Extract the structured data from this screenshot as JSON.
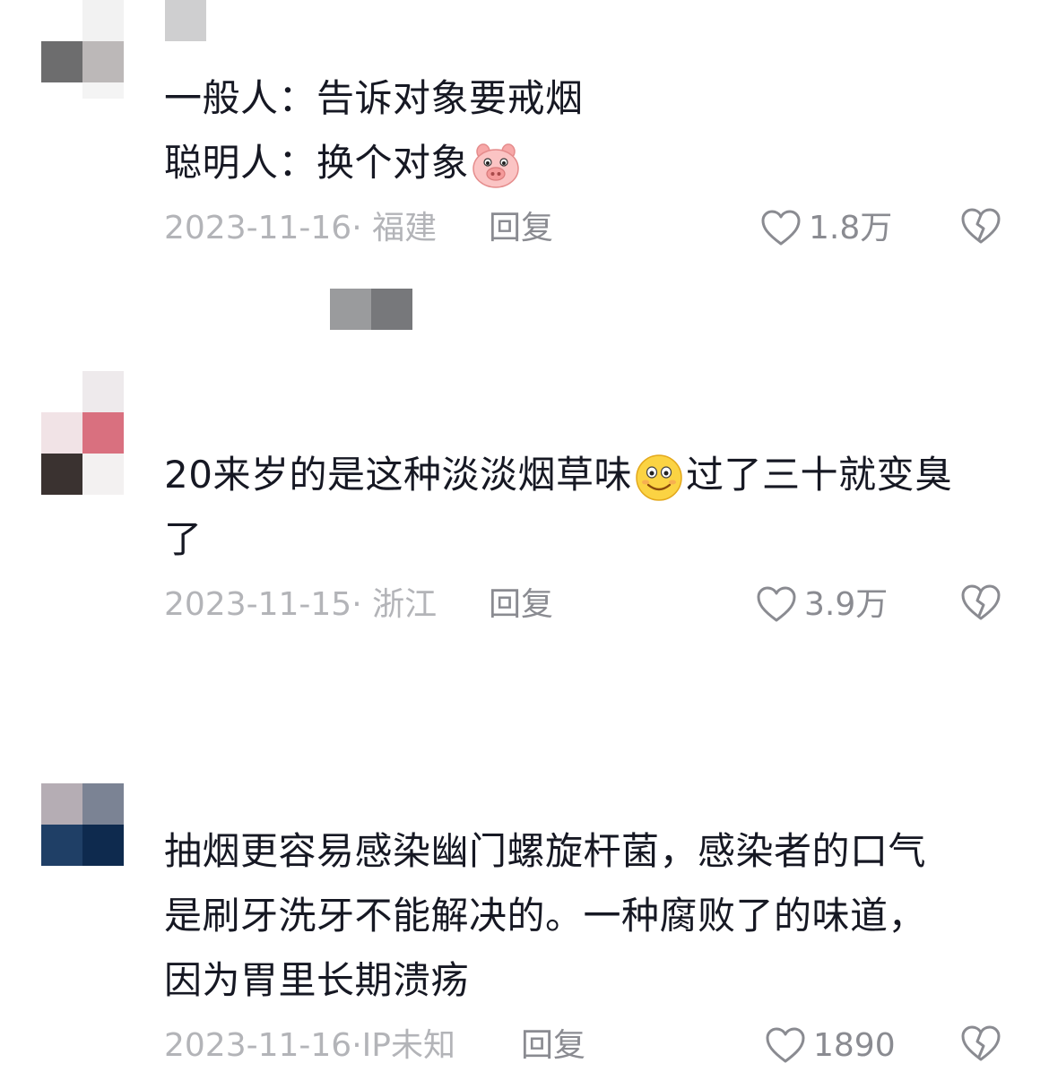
{
  "comments": [
    {
      "line1": "一般人：告诉对象要戒烟",
      "line2": "聪明人：换个对象",
      "emoji": "pig-face-icon",
      "date": "2023-11-16· 福建",
      "reply": "回复",
      "likes": "1.8万"
    },
    {
      "line1_before": "20来岁的是这种淡淡烟草味",
      "emoji": "smiling-face-icon",
      "line1_after": "过了三十就变臭",
      "line2": "了",
      "date": "2023-11-15· 浙江",
      "reply": "回复",
      "likes": "3.9万"
    },
    {
      "line1": "抽烟更容易感染幽门螺旋杆菌，感染者的口气",
      "line2": "是刷牙洗牙不能解决的。一种腐败了的味道，",
      "line3": "因为胃里长期溃疡",
      "date": "2023-11-16·IP未知",
      "reply": "回复",
      "likes": "1890"
    }
  ],
  "icons": {
    "like": "heart-outline-icon",
    "dislike": "broken-heart-icon"
  },
  "colors": {
    "text": "#161823",
    "meta": "#b3b4b8",
    "action": "#8a8b91"
  }
}
